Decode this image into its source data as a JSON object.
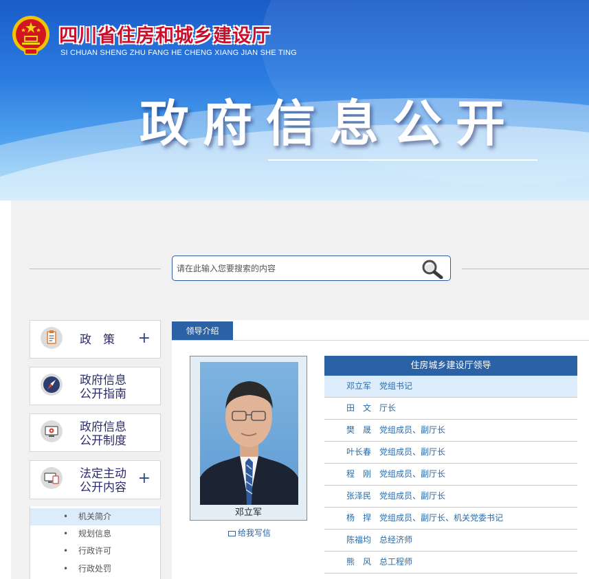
{
  "header": {
    "logo_cn": "四川省住房和城乡建设厅",
    "logo_en": "SI CHUAN SHENG ZHU FANG HE CHENG XIANG JIAN SHE TING",
    "page_title": "政府信息公开"
  },
  "search": {
    "placeholder": "请在此输入您要搜索的内容"
  },
  "sidebar": {
    "items": [
      {
        "label": "政　策",
        "has_plus": true,
        "icon": "clipboard-icon"
      },
      {
        "label": "政府信息\n公开指南",
        "has_plus": false,
        "icon": "compass-icon"
      },
      {
        "label": "政府信息\n公开制度",
        "has_plus": false,
        "icon": "settings-screen-icon"
      },
      {
        "label": "法定主动\n公开内容",
        "has_plus": true,
        "icon": "monitor-icon"
      }
    ],
    "plus_symbol": "+",
    "subitems": [
      "机关简介",
      "规划信息",
      "行政许可",
      "行政处罚"
    ],
    "subitem_bullet": "•"
  },
  "main": {
    "tab_label": "领导介绍",
    "photo_name": "邓立军",
    "write_link": "给我写信",
    "leaders_title": "住房城乡建设厅领导",
    "leaders": [
      {
        "name": "邓立军",
        "position": "党组书记"
      },
      {
        "name": "田　文",
        "position": "厅长"
      },
      {
        "name": "樊　晟",
        "position": "党组成员、副厅长"
      },
      {
        "name": "叶长春",
        "position": "党组成员、副厅长"
      },
      {
        "name": "程　刚",
        "position": "党组成员、副厅长"
      },
      {
        "name": "张泽民",
        "position": "党组成员、副厅长"
      },
      {
        "name": "杨　捍",
        "position": "党组成员、副厅长、机关党委书记"
      },
      {
        "name": "陈福均",
        "position": "总经济师"
      },
      {
        "name": "熊　风",
        "position": "总工程师"
      }
    ]
  },
  "colors": {
    "brand_blue": "#2b62a6",
    "logo_red": "#c8102e",
    "highlight_row": "#dcecfa"
  }
}
